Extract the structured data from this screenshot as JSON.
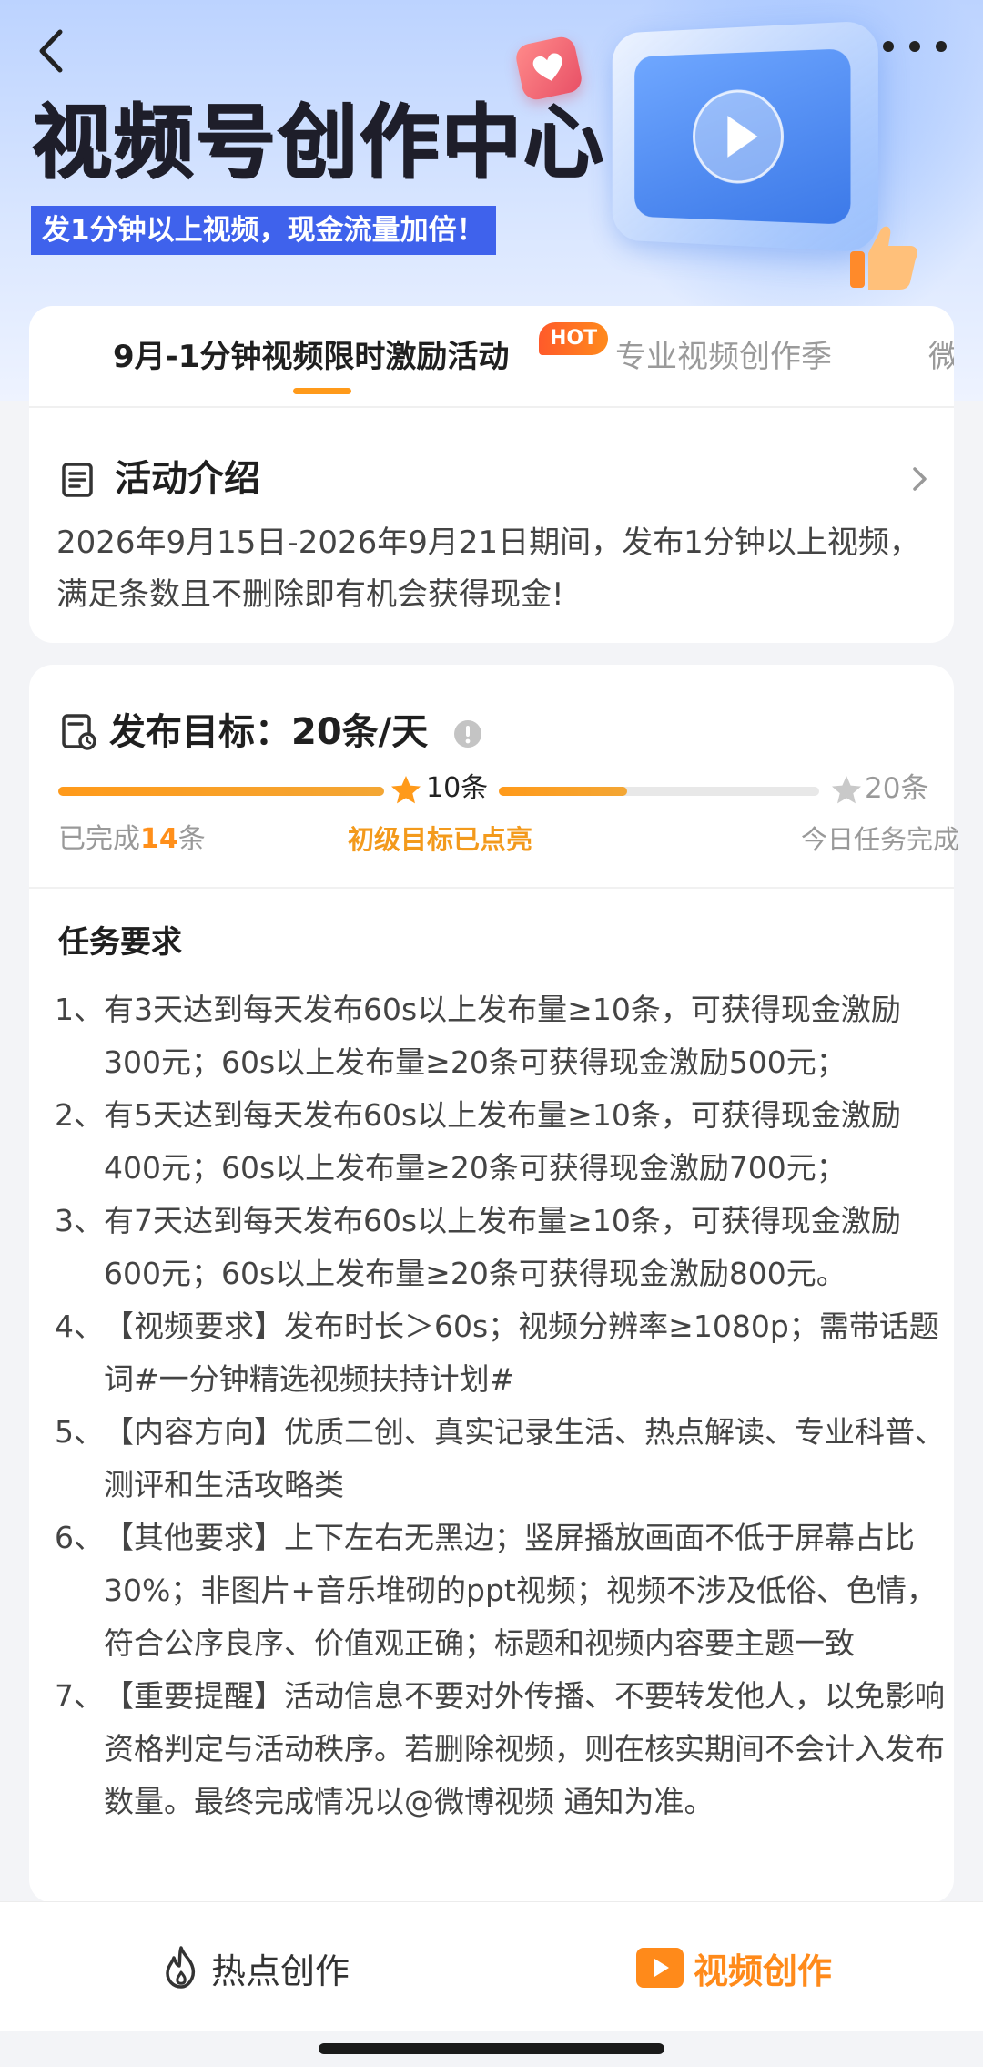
{
  "header": {
    "title": "视频号创作中心",
    "subtitle": "发1分钟以上视频，现金流量加倍！"
  },
  "tabs": [
    {
      "label": "9月-1分钟视频限时激励活动",
      "badge": "HOT"
    },
    {
      "label": "专业视频创作季"
    },
    {
      "label": "微"
    }
  ],
  "intro": {
    "title": "活动介绍",
    "description": "2026年9月15日-2026年9月21日期间，发布1分钟以上视频，满足条数且不删除即有机会获得现金!"
  },
  "goal": {
    "title": "发布目标：20条/天",
    "completed_prefix": "已完成",
    "completed_count": "14",
    "completed_suffix": "条",
    "completed_value": 14,
    "milestone_mid": "10条",
    "milestone_end": "20条",
    "milestone_end_value": 20,
    "level_text": "初级目标已点亮",
    "today_text": "今日任务完成"
  },
  "requirements": {
    "title": "任务要求",
    "items": [
      {
        "num": "1、",
        "text": "有3天达到每天发布60s以上发布量≥10条，可获得现金激励300元；60s以上发布量≥20条可获得现金激励500元；"
      },
      {
        "num": "2、",
        "text": "有5天达到每天发布60s以上发布量≥10条，可获得现金激励400元；60s以上发布量≥20条可获得现金激励700元；"
      },
      {
        "num": "3、",
        "text": "有7天达到每天发布60s以上发布量≥10条，可获得现金激励600元；60s以上发布量≥20条可获得现金激励800元。"
      },
      {
        "num": "4、",
        "text": "【视频要求】发布时长＞60s；视频分辨率≥1080p；需带话题词#一分钟精选视频扶持计划#"
      },
      {
        "num": "5、",
        "text": "【内容方向】优质二创、真实记录生活、热点解读、专业科普、测评和生活攻略类"
      },
      {
        "num": "6、",
        "text": "【其他要求】上下左右无黑边；竖屏播放画面不低于屏幕占比30%；非图片+音乐堆砌的ppt视频；视频不涉及低俗、色情，符合公序良序、价值观正确；标题和视频内容要主题一致"
      },
      {
        "num": "7、",
        "text": "【重要提醒】活动信息不要对外传播、不要转发他人，以免影响资格判定与活动秩序。若删除视频，则在核实期间不会计入发布数量。最终完成情况以@微博视频 通知为准。"
      }
    ]
  },
  "bottom_nav": {
    "hot_label": "热点创作",
    "video_label": "视频创作"
  },
  "colors": {
    "accent": "#ff9a1a",
    "brand_blue": "#3f62ec",
    "hot_badge": "#ff5a2a"
  },
  "icons": {
    "back": "chevron-left-icon",
    "more": "more-dots-icon",
    "intro": "document-icon",
    "goal": "clock-document-icon",
    "info": "info-icon",
    "star": "star-icon",
    "hot": "flame-icon",
    "video": "video-play-icon"
  }
}
